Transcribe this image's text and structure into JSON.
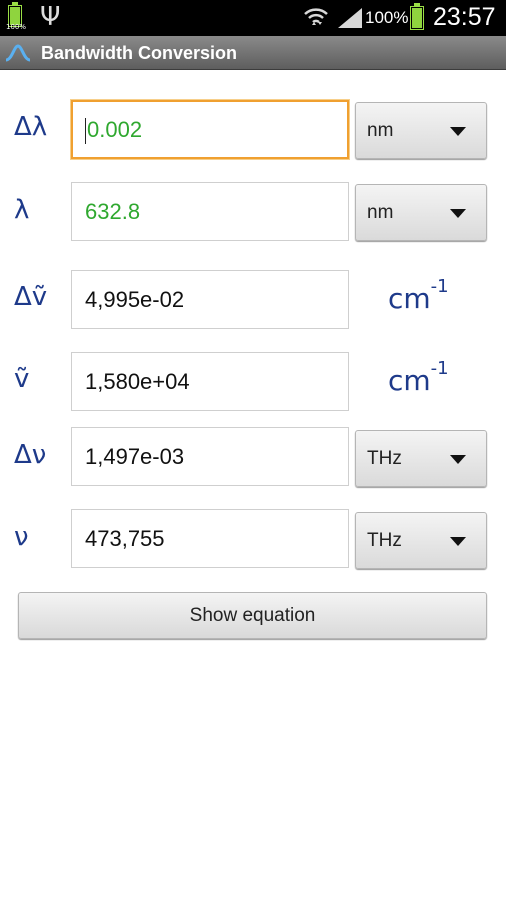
{
  "status_bar": {
    "small_battery_pct": "100%",
    "battery_pct": "100%",
    "time": "23:57",
    "battery_level": 1.0
  },
  "app": {
    "title": "Bandwidth Conversion",
    "icon": "gaussian-peak-icon"
  },
  "rows": [
    {
      "symbol": "Δλ",
      "value": "0.002",
      "unit": "nm"
    },
    {
      "symbol": "λ",
      "value": "632.8",
      "unit": "nm"
    },
    {
      "symbol": "Δṽ",
      "value": "4,995e-02",
      "unit": "cm",
      "unit_exp": "-1"
    },
    {
      "symbol": "ṽ",
      "value": "1,580e+04",
      "unit": "cm",
      "unit_exp": "-1"
    },
    {
      "symbol": "Δν",
      "value": "1,497e-03",
      "unit": "THz"
    },
    {
      "symbol": "ν",
      "value": "473,755",
      "unit": "THz"
    }
  ],
  "show_button": "Show equation",
  "colors": {
    "input_green": "#2fa82f",
    "label_blue": "#1e3a8a",
    "focus_orange": "#f0a030"
  }
}
